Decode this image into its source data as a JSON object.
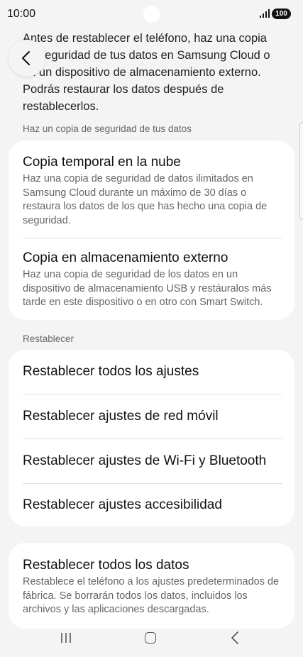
{
  "status_bar": {
    "time": "10:00",
    "battery": "100"
  },
  "intro": {
    "text": "Antes de restablecer el teléfono, haz una copia de seguridad de tus datos en Samsung Cloud o en un dispositivo de almacenamiento externo. Podrás restaurar los datos después de restablecerlos."
  },
  "backup": {
    "header": "Haz un copia de seguridad de tus datos",
    "items": [
      {
        "title": "Copia temporal en la nube",
        "description": "Haz una copia de seguridad de datos ilimitados en Samsung Cloud durante un máximo de 30 días o restaura los datos de los que has hecho una copia de seguridad."
      },
      {
        "title": "Copia en almacenamiento externo",
        "description": "Haz una copia de seguridad de los datos en un dispositivo de almacenamiento USB y restáuralos más tarde en este dispositivo o en otro con Smart Switch."
      }
    ]
  },
  "reset": {
    "header": "Restablecer",
    "items": [
      {
        "title": "Restablecer todos los ajustes"
      },
      {
        "title": "Restablecer ajustes de red móvil"
      },
      {
        "title": "Restablecer ajustes de Wi-Fi y Bluetooth"
      },
      {
        "title": "Restablecer ajustes accesibilidad"
      }
    ]
  },
  "factory_reset": {
    "title": "Restablecer todos los datos",
    "description": "Restablece el teléfono a los ajustes predeterminados de fábrica. Se borrarán todos los datos, incluidos los archivos y las aplicaciones descargadas."
  },
  "icons": {
    "back": "back-arrow-icon",
    "signal": "signal-icon",
    "nav_recent": "recent-apps-icon",
    "nav_home": "home-icon",
    "nav_back": "nav-back-icon"
  }
}
